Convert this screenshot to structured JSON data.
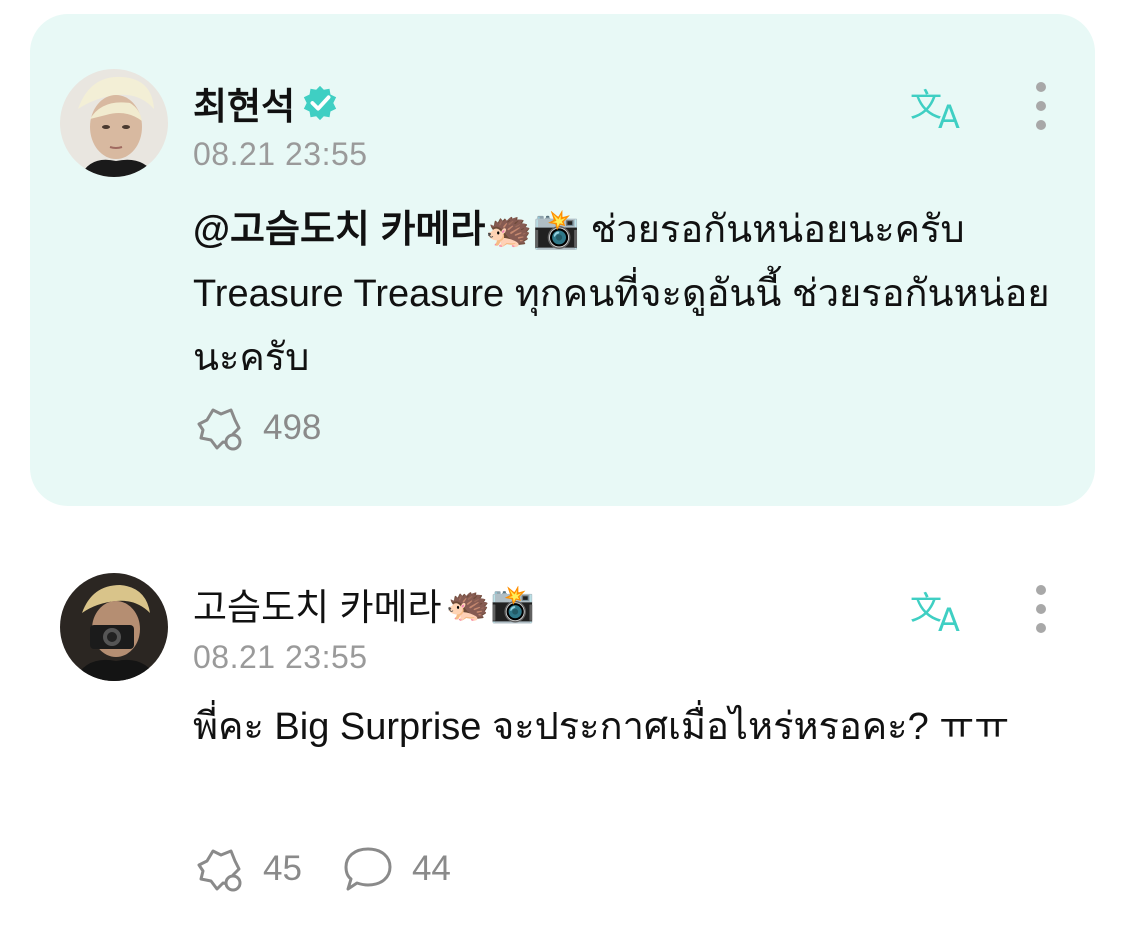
{
  "posts": [
    {
      "author": "최현석",
      "verified": true,
      "timestamp": "08.21 23:55",
      "mention": "@고슴도치 카메라🦔📸",
      "text": " ช่วยรอกันหน่อยนะครับ Treasure Treasure ทุกคนที่จะดูอันนี้ ช่วยรอกันหน่อยนะครับ",
      "likes": "498"
    },
    {
      "author": "고슴도치 카메라",
      "author_emoji": "🦔📸",
      "timestamp": "08.21 23:55",
      "text": "พี่คะ Big Surprise จะประกาศเมื่อไหร่หรอคะ? ㅠㅠ",
      "likes": "45",
      "comments": "44"
    }
  ],
  "icons": {
    "translate": "translate-icon",
    "more": "more-vertical-icon",
    "like": "like-icon",
    "comment": "comment-icon",
    "verified": "verified-badge-icon"
  },
  "colors": {
    "highlight_bg": "#e8f9f6",
    "accent": "#3fcfc3",
    "muted": "#9a9a9a"
  }
}
